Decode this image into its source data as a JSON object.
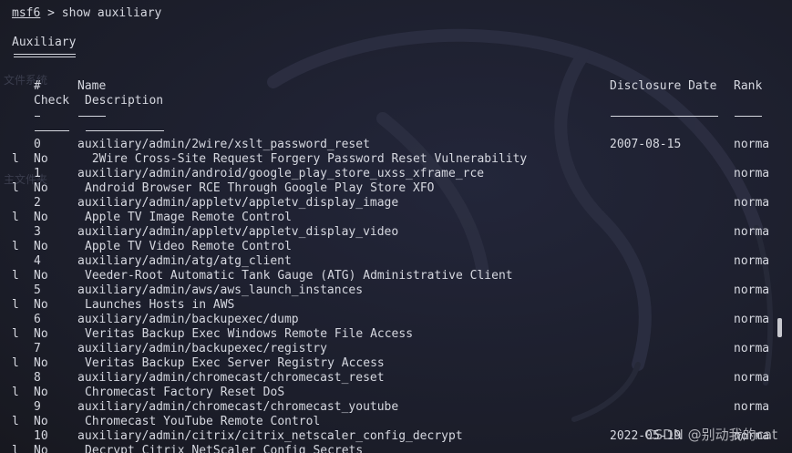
{
  "prompt": {
    "name": "msf6",
    "command": " > show auxiliary"
  },
  "section_title": "Auxiliary",
  "section_underline": "=========",
  "headers": {
    "number": "#",
    "name": "Name",
    "check": "Check",
    "description": "Description",
    "disclosure_date": "Disclosure Date",
    "rank": "Rank"
  },
  "rows": [
    {
      "index": "0",
      "name": "auxiliary/admin/2wire/xslt_password_reset",
      "date": "2007-08-15",
      "rank": "norma",
      "wrap": "l",
      "check": "No",
      "description": " 2Wire Cross-Site Request Forgery Password Reset Vulnerability"
    },
    {
      "index": "1",
      "name": "auxiliary/admin/android/google_play_store_uxss_xframe_rce",
      "date": "",
      "rank": "norma",
      "wrap": "l",
      "check": "No",
      "description": "Android Browser RCE Through Google Play Store XFO"
    },
    {
      "index": "2",
      "name": "auxiliary/admin/appletv/appletv_display_image",
      "date": "",
      "rank": "norma",
      "wrap": "l",
      "check": "No",
      "description": "Apple TV Image Remote Control"
    },
    {
      "index": "3",
      "name": "auxiliary/admin/appletv/appletv_display_video",
      "date": "",
      "rank": "norma",
      "wrap": "l",
      "check": "No",
      "description": "Apple TV Video Remote Control"
    },
    {
      "index": "4",
      "name": "auxiliary/admin/atg/atg_client",
      "date": "",
      "rank": "norma",
      "wrap": "l",
      "check": "No",
      "description": "Veeder-Root Automatic Tank Gauge (ATG) Administrative Client"
    },
    {
      "index": "5",
      "name": "auxiliary/admin/aws/aws_launch_instances",
      "date": "",
      "rank": "norma",
      "wrap": "l",
      "check": "No",
      "description": "Launches Hosts in AWS"
    },
    {
      "index": "6",
      "name": "auxiliary/admin/backupexec/dump",
      "date": "",
      "rank": "norma",
      "wrap": "l",
      "check": "No",
      "description": "Veritas Backup Exec Windows Remote File Access"
    },
    {
      "index": "7",
      "name": "auxiliary/admin/backupexec/registry",
      "date": "",
      "rank": "norma",
      "wrap": "l",
      "check": "No",
      "description": "Veritas Backup Exec Server Registry Access"
    },
    {
      "index": "8",
      "name": "auxiliary/admin/chromecast/chromecast_reset",
      "date": "",
      "rank": "norma",
      "wrap": "l",
      "check": "No",
      "description": "Chromecast Factory Reset DoS"
    },
    {
      "index": "9",
      "name": "auxiliary/admin/chromecast/chromecast_youtube",
      "date": "",
      "rank": "norma",
      "wrap": "l",
      "check": "No",
      "description": "Chromecast YouTube Remote Control"
    },
    {
      "index": "10",
      "name": "auxiliary/admin/citrix/citrix_netscaler_config_decrypt",
      "date": "2022-05-19",
      "rank": "norma",
      "wrap": "l",
      "check": "No",
      "description": "Decrypt Citrix NetScaler Config Secrets"
    }
  ],
  "watermark": "CSDN @别动我的cat",
  "ghost_text": [
    "文件系统",
    "主文件夹"
  ],
  "colors": {
    "background": "#1d1f2c",
    "foreground": "#d6d8e0"
  }
}
